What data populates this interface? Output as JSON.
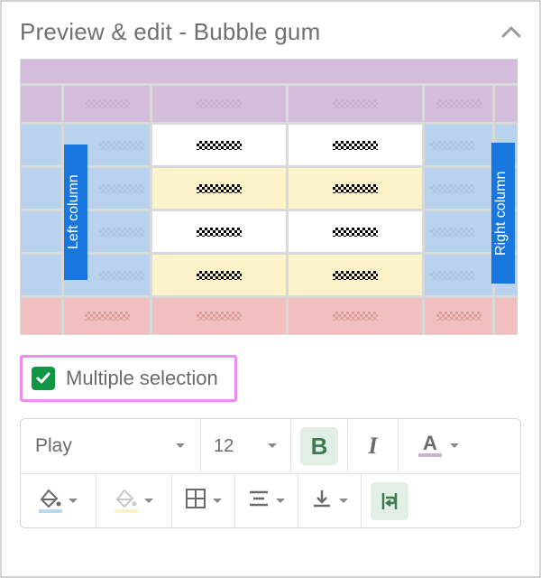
{
  "header": {
    "title": "Preview & edit - Bubble gum"
  },
  "preview": {
    "left_label": "Left column",
    "right_label": "Right column",
    "colors": {
      "header": "#d4bcdc",
      "side": "#b9d2ed",
      "alt_row": "#fdf3c8",
      "footer": "#f2bfc0",
      "selected": "#1877de"
    }
  },
  "multi": {
    "label": "Multiple selection",
    "checked": true
  },
  "toolbar": {
    "font": {
      "value": "Play"
    },
    "size": {
      "value": "12"
    },
    "bold_active": true,
    "font_color": "#cdb3d3",
    "fill_color_1": "#b9d9ee",
    "fill_color_2": "#fdf2c3"
  }
}
